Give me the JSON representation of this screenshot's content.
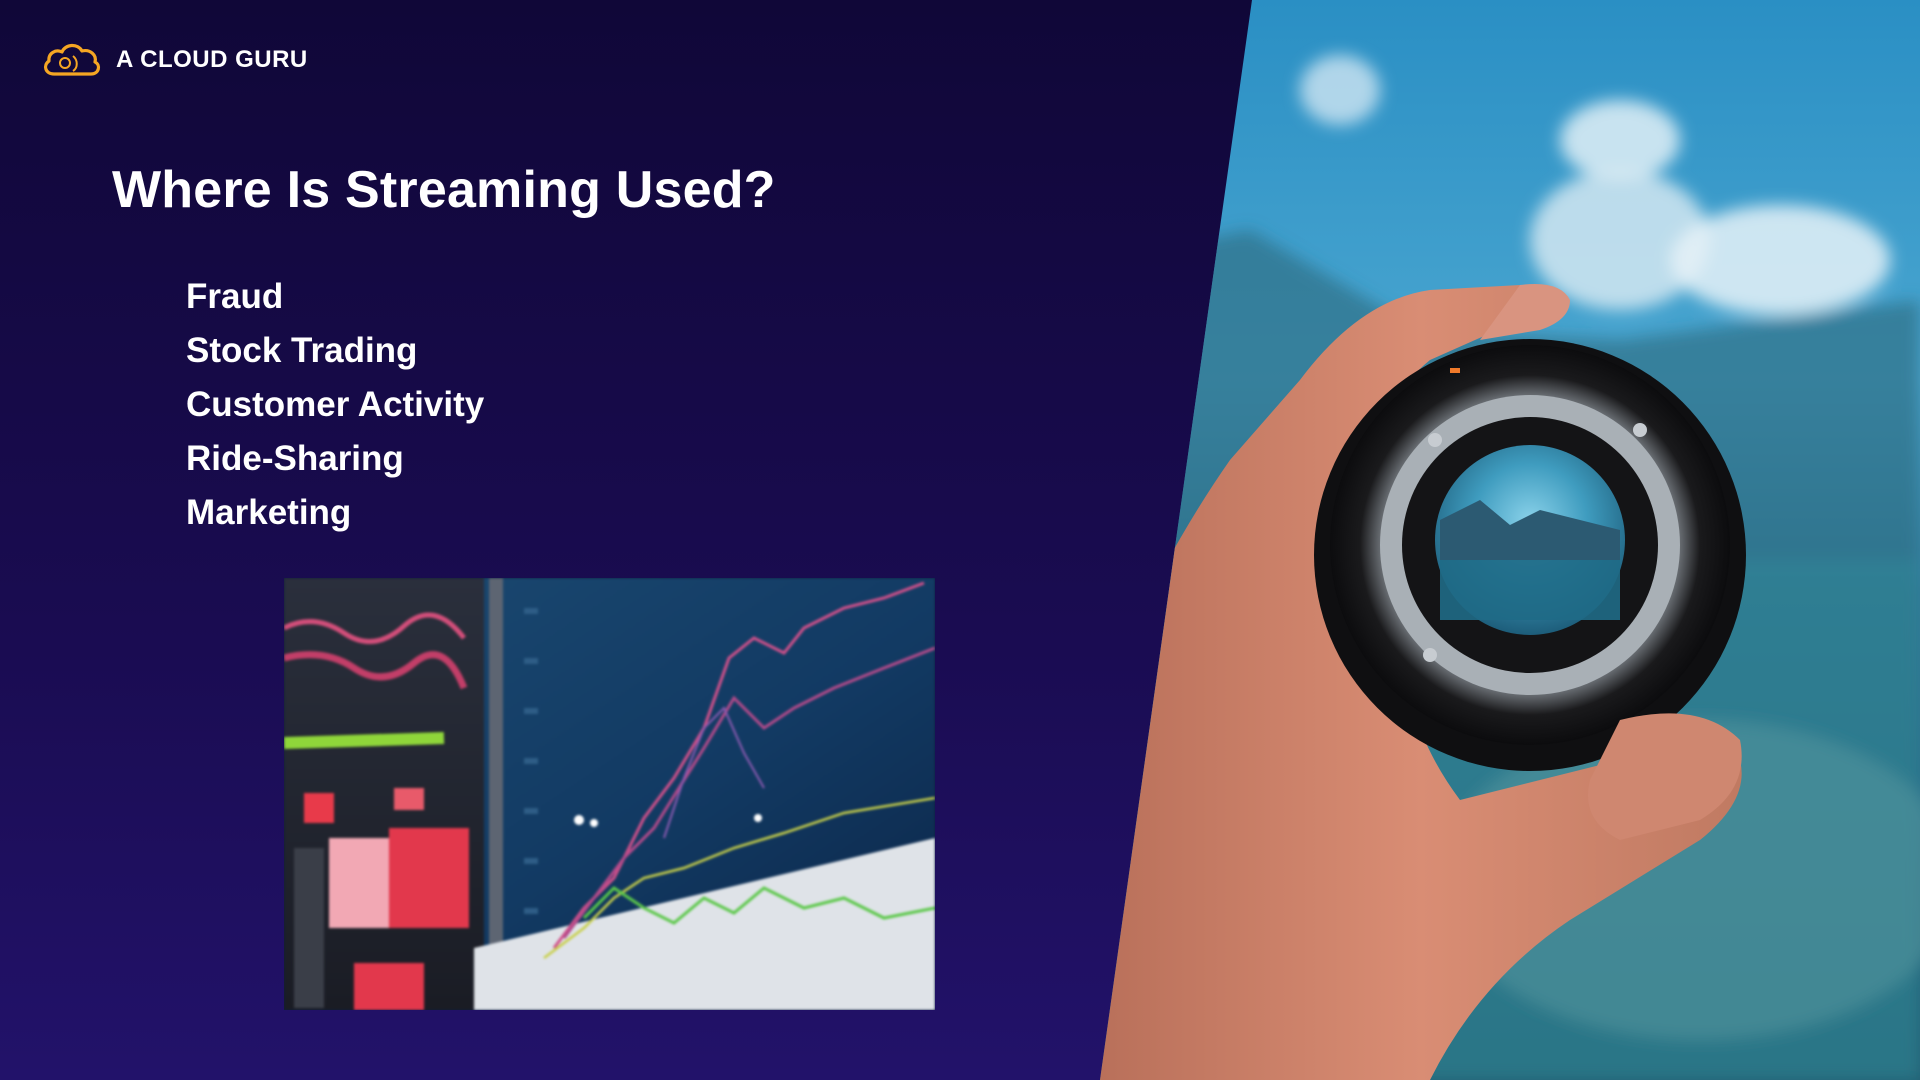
{
  "brand": {
    "name": "A CLOUD GURU",
    "logo_icon": "cloud-logo-icon",
    "accent_color": "#f5a623"
  },
  "slide": {
    "title": "Where Is Streaming Used?",
    "items": [
      "Fraud",
      "Stock Trading",
      "Customer Activity",
      "Ride-Sharing",
      "Marketing"
    ],
    "background_color": "#16083f",
    "text_color": "#ffffff"
  },
  "images": {
    "chart_photo": "stock-trading-chart-photo",
    "lens_photo": "hand-holding-camera-lens-photo"
  }
}
